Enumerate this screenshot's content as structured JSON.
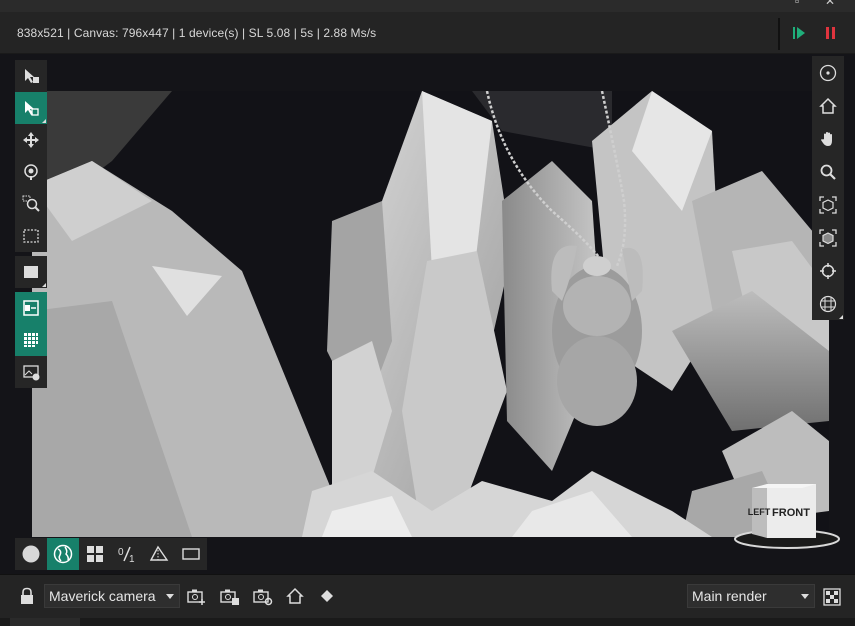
{
  "status": {
    "text": "838x521 | Canvas: 796x447 | 1 device(s) | SL 5.08 | 5s | 2.88 Ms/s"
  },
  "colors": {
    "accent": "#17806a",
    "play": "#1fae7a",
    "pause": "#e0343e",
    "background": "#111116"
  },
  "left_toolbar": {
    "tools": [
      {
        "icon": "select-lock-icon",
        "active": false
      },
      {
        "icon": "select-object-icon",
        "active": true
      },
      {
        "icon": "move-icon",
        "active": false
      },
      {
        "icon": "pick-focus-icon",
        "active": false
      },
      {
        "icon": "zoom-region-icon",
        "active": false
      },
      {
        "icon": "region-render-icon",
        "active": false
      },
      {
        "icon": "square-icon",
        "active": false
      },
      {
        "icon": "panel-toggle-icon",
        "active": true
      },
      {
        "icon": "grid-icon",
        "active": true
      },
      {
        "icon": "image-camera-icon",
        "active": false
      }
    ]
  },
  "right_toolbar": {
    "tools": [
      "target-circle-icon",
      "home-icon",
      "pan-hand-icon",
      "zoom-icon",
      "frame-object-icon",
      "frame-all-icon",
      "crosshair-icon",
      "grid-plane-icon"
    ]
  },
  "bottom_toolbar": {
    "tools": [
      "sphere-icon",
      "globe-icon",
      "four-views-icon",
      "ratio-icon",
      "perspective-icon",
      "frame-rect-icon"
    ],
    "ratio_label": "⁰⁄₁"
  },
  "navcube": {
    "left_label": "LEFT",
    "front_label": "FRONT"
  },
  "footer": {
    "camera_select": "Maverick camera",
    "render_select": "Main render"
  }
}
